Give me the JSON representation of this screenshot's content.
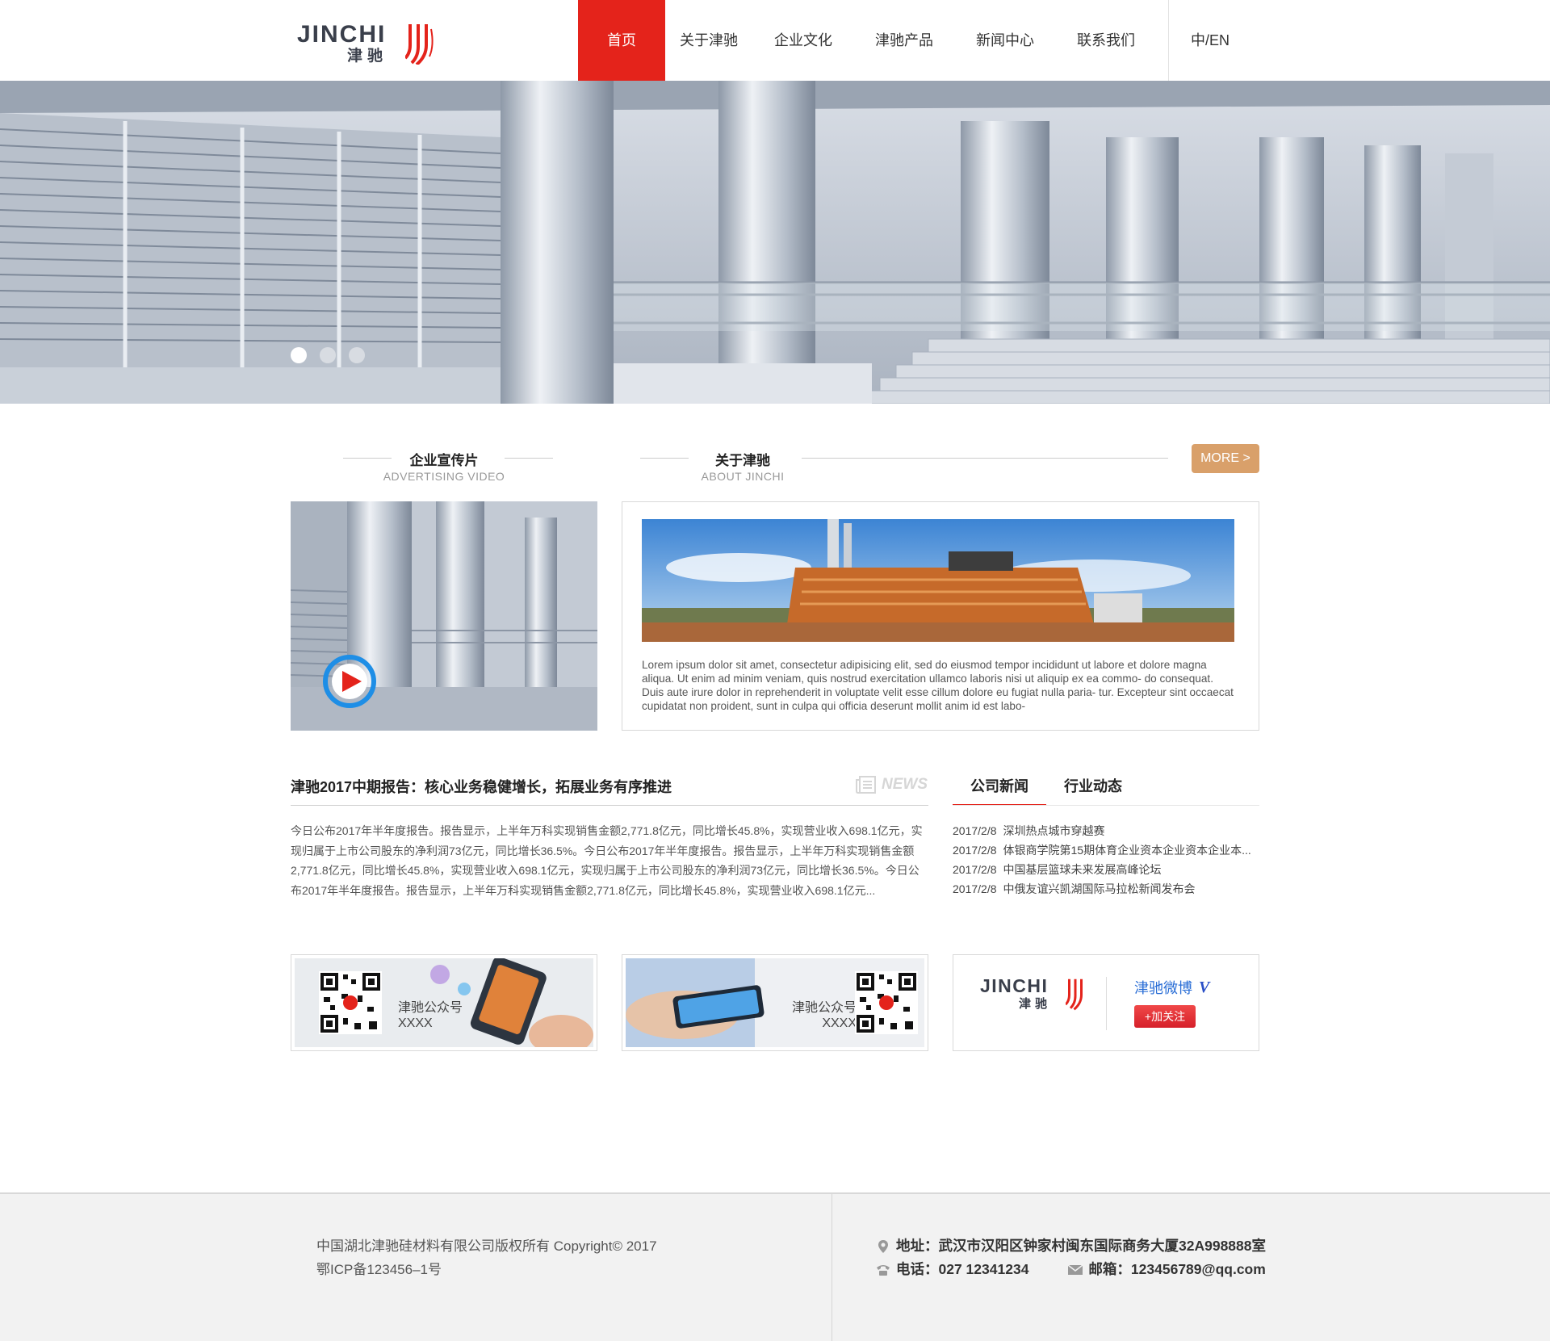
{
  "header": {
    "logo_word": "JINCHI",
    "logo_cn": "津驰",
    "nav": [
      "首页",
      "关于津驰",
      "企业文化",
      "津驰产品",
      "新闻中心",
      "联系我们"
    ],
    "lang": "中/EN"
  },
  "banner": {
    "slides": 3,
    "active_slide": 1
  },
  "video_section": {
    "title_cn": "企业宣传片",
    "title_en": "ADVERTISING VIDEO"
  },
  "about_section": {
    "title_cn": "关于津驰",
    "title_en": "ABOUT JINCHI",
    "more": "MORE >",
    "text": "Lorem ipsum dolor sit amet, consectetur adipisicing elit, sed do eiusmod tempor incididunt ut labore et dolore magna aliqua. Ut enim ad minim veniam, quis nostrud exercitation ullamco laboris nisi ut aliquip ex ea commo- do consequat. Duis aute irure dolor in reprehenderit in voluptate velit esse cillum dolore eu fugiat nulla paria- tur. Excepteur sint occaecat cupidatat non proident, sunt in culpa qui officia deserunt mollit anim id est labo-"
  },
  "news": {
    "headline": "津驰2017中期报告：核心业务稳健增长，拓展业务有序推进",
    "label": "NEWS",
    "body": "今日公布2017年半年度报告。报告显示，上半年万科实现销售金额2,771.8亿元，同比增长45.8%，实现营业收入698.1亿元，实现归属于上市公司股东的净利润73亿元，同比增长36.5%。今日公布2017年半年度报告。报告显示，上半年万科实现销售金额2,771.8亿元，同比增长45.8%，实现营业收入698.1亿元，实现归属于上市公司股东的净利润73亿元，同比增长36.5%。今日公布2017年半年度报告。报告显示，上半年万科实现销售金额2,771.8亿元，同比增长45.8%，实现营业收入698.1亿元..."
  },
  "tabs": [
    "公司新闻",
    "行业动态"
  ],
  "news_list": [
    {
      "date": "2017/2/8",
      "title": "深圳热点城市穿越赛"
    },
    {
      "date": "2017/2/8",
      "title": "体银商学院第15期体育企业资本企业资本企业本..."
    },
    {
      "date": "2017/2/8",
      "title": "中国基层篮球未来发展高峰论坛"
    },
    {
      "date": "2017/2/8",
      "title": "中俄友谊兴凯湖国际马拉松新闻发布会"
    }
  ],
  "cards": [
    {
      "name": "津驰公众号",
      "id": "XXXX"
    },
    {
      "name": "津驰公众号",
      "id": "XXXX"
    }
  ],
  "weibo": {
    "name": "津驰微博",
    "v": "V",
    "follow": "+加关注"
  },
  "footer": {
    "copyright": "中国湖北津驰硅材料有限公司版权所有 Copyright© 2017",
    "icp": "鄂ICP备123456–1号",
    "address": "地址：武汉市汉阳区钟家村闽东国际商务大厦32A998888室",
    "phone": "电话：027 12341234",
    "email": "邮箱：123456789@qq.com"
  },
  "colors": {
    "brand_red": "#e4231b",
    "more_button": "#d9a06a",
    "weibo_blue": "#2a6ed6"
  }
}
